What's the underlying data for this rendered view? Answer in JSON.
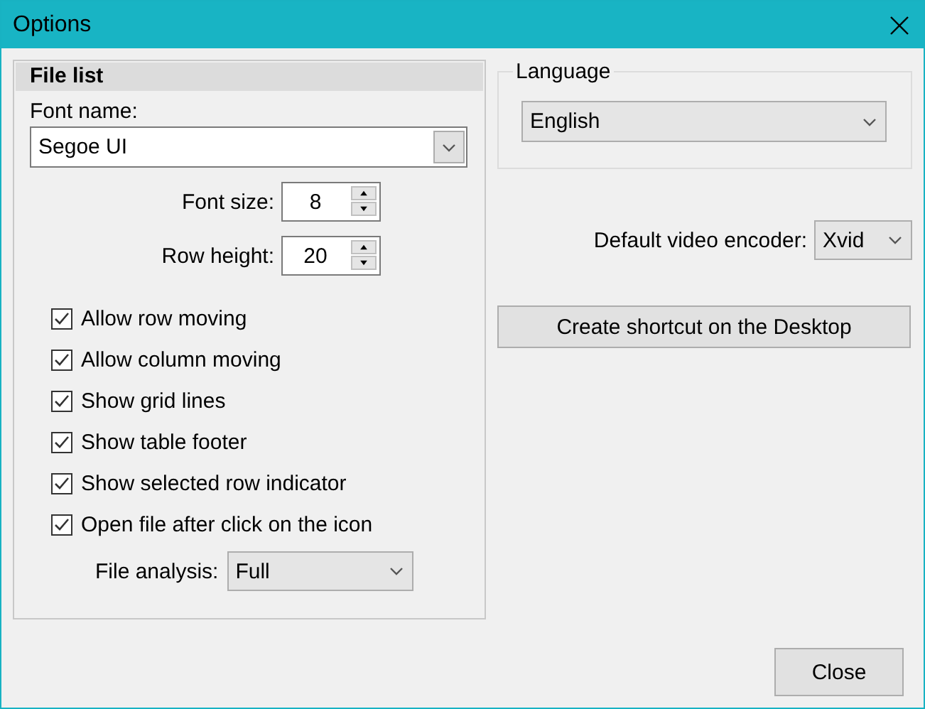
{
  "window": {
    "title": "Options"
  },
  "file_list": {
    "title": "File list",
    "font_name": {
      "label": "Font name:",
      "value": "Segoe UI"
    },
    "font_size": {
      "label": "Font size:",
      "value": "8"
    },
    "row_height": {
      "label": "Row height:",
      "value": "20"
    },
    "options": [
      {
        "label": "Allow row moving",
        "checked": true
      },
      {
        "label": "Allow column moving",
        "checked": true
      },
      {
        "label": "Show grid lines",
        "checked": true
      },
      {
        "label": "Show table footer",
        "checked": true
      },
      {
        "label": "Show selected row indicator",
        "checked": true
      },
      {
        "label": "Open file after click on the icon",
        "checked": true
      }
    ],
    "file_analysis": {
      "label": "File analysis:",
      "value": "Full"
    }
  },
  "language": {
    "title": "Language",
    "value": "English"
  },
  "video_encoder": {
    "label": "Default video encoder:",
    "value": "Xvid"
  },
  "shortcut_button": "Create shortcut on the Desktop",
  "close_button": "Close"
}
